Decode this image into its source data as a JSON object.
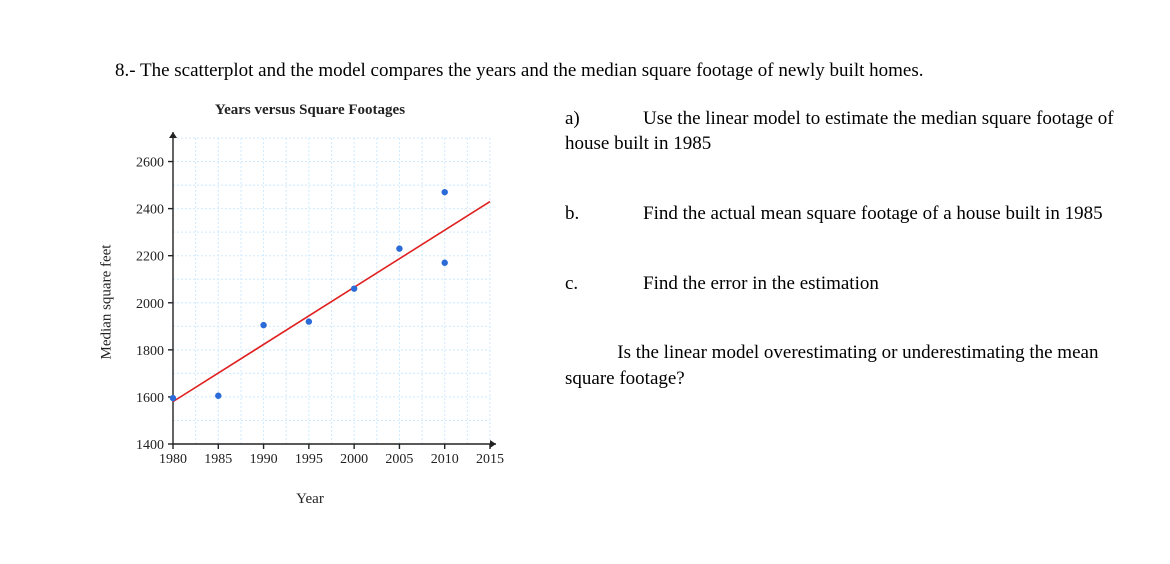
{
  "problem": {
    "number": "8.-",
    "intro": "The scatterplot and the model compares the years and the median square footage of newly built homes."
  },
  "questions": {
    "a_label": "a)",
    "a_text": "Use the linear model to estimate the median square footage of house built in 1985",
    "b_label": "b.",
    "b_text": "Find the actual mean square footage of a house built in 1985",
    "c_label": "c.",
    "c_text": "Find the error in the estimation",
    "d_text": "Is the linear model overestimating or underestimating  the mean square footage?"
  },
  "chart_data": {
    "type": "scatter",
    "title": "Years versus Square Footages",
    "xlabel": "Year",
    "ylabel": "Median square feet",
    "x_ticks": [
      1980,
      1985,
      1990,
      1995,
      2000,
      2005,
      2010,
      2015
    ],
    "y_ticks": [
      1400,
      1600,
      1800,
      2000,
      2200,
      2400,
      2600
    ],
    "xlim": [
      1980,
      2015
    ],
    "ylim": [
      1400,
      2700
    ],
    "points": [
      {
        "x": 1980,
        "y": 1595
      },
      {
        "x": 1985,
        "y": 1605
      },
      {
        "x": 1990,
        "y": 1905
      },
      {
        "x": 1995,
        "y": 1920
      },
      {
        "x": 2000,
        "y": 2060
      },
      {
        "x": 2005,
        "y": 2230
      },
      {
        "x": 2010,
        "y": 2170
      },
      {
        "x": 2010,
        "y": 2470
      }
    ],
    "trend_line": {
      "x1": 1980,
      "y1": 1580,
      "x2": 2015,
      "y2": 2430
    }
  }
}
